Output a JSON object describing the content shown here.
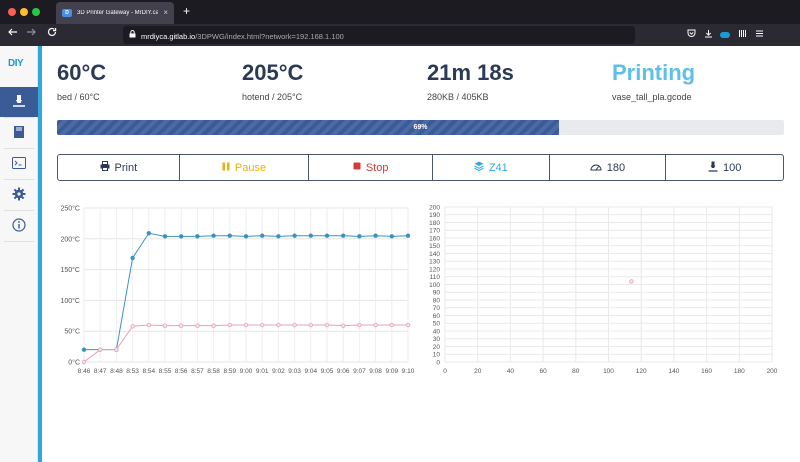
{
  "browser": {
    "tab_title": "3D Printer Gateway - MrDIY.ca",
    "tab_close": "×",
    "new_tab": "+",
    "url_host": "mrdiyca.gitlab.io",
    "url_path": "/3DPWG/index.html?network=192.168.1.100"
  },
  "logo": {
    "text_a": "D",
    "text_b": "IY"
  },
  "stats": {
    "bed": {
      "value": "60°C",
      "sub": "bed / 60°C"
    },
    "hotend": {
      "value": "205°C",
      "sub": "hotend / 205°C"
    },
    "time": {
      "value": "21m 18s",
      "sub": "280KB / 405KB"
    },
    "status": {
      "value": "Printing",
      "sub": "vase_tall_pla.gcode"
    }
  },
  "progress": {
    "label": "69%",
    "fraction": 0.69
  },
  "controls": {
    "print": "Print",
    "pause": "Pause",
    "stop": "Stop",
    "z": "Z41",
    "speed": "180",
    "flow": "100"
  },
  "colors": {
    "primary": "#3b5b96",
    "accent": "#2fa8dc",
    "status": "#5fbfea",
    "hotend_line": "#3a92c0",
    "bed_line": "#e8a1b1"
  },
  "chart_data": [
    {
      "type": "line",
      "categories": [
        "8:46",
        "8:47",
        "8:48",
        "8:53",
        "8:54",
        "8:55",
        "8:56",
        "8:57",
        "8:58",
        "8:59",
        "9:00",
        "9:01",
        "9:02",
        "9:03",
        "9:04",
        "9:05",
        "9:06",
        "9:07",
        "9:08",
        "9:09",
        "9:10"
      ],
      "series": [
        {
          "values": [
            20,
            20,
            20,
            169,
            209,
            204,
            204,
            204,
            205,
            205,
            204,
            205,
            204,
            205,
            205,
            205,
            205,
            204,
            205,
            204,
            205
          ]
        },
        {
          "values": [
            0,
            20,
            20,
            58,
            60,
            59,
            59,
            59,
            59,
            60,
            60,
            60,
            60,
            60,
            60,
            60,
            59,
            60,
            60,
            60,
            60
          ]
        }
      ],
      "yticks": [
        "0°C",
        "50°C",
        "100°C",
        "150°C",
        "200°C",
        "250°C"
      ],
      "ylim": [
        0,
        250
      ],
      "grid": true
    },
    {
      "type": "scatter",
      "points": [
        {
          "x": 114,
          "y": 104
        }
      ],
      "xticks": [
        "0",
        "20",
        "40",
        "60",
        "80",
        "100",
        "120",
        "140",
        "160",
        "180",
        "200"
      ],
      "yticks": [
        "0",
        "10",
        "20",
        "30",
        "40",
        "50",
        "60",
        "70",
        "80",
        "90",
        "100",
        "110",
        "120",
        "130",
        "140",
        "150",
        "160",
        "170",
        "180",
        "190",
        "200"
      ],
      "xlim": [
        0,
        200
      ],
      "ylim": [
        0,
        200
      ],
      "grid": true
    }
  ]
}
